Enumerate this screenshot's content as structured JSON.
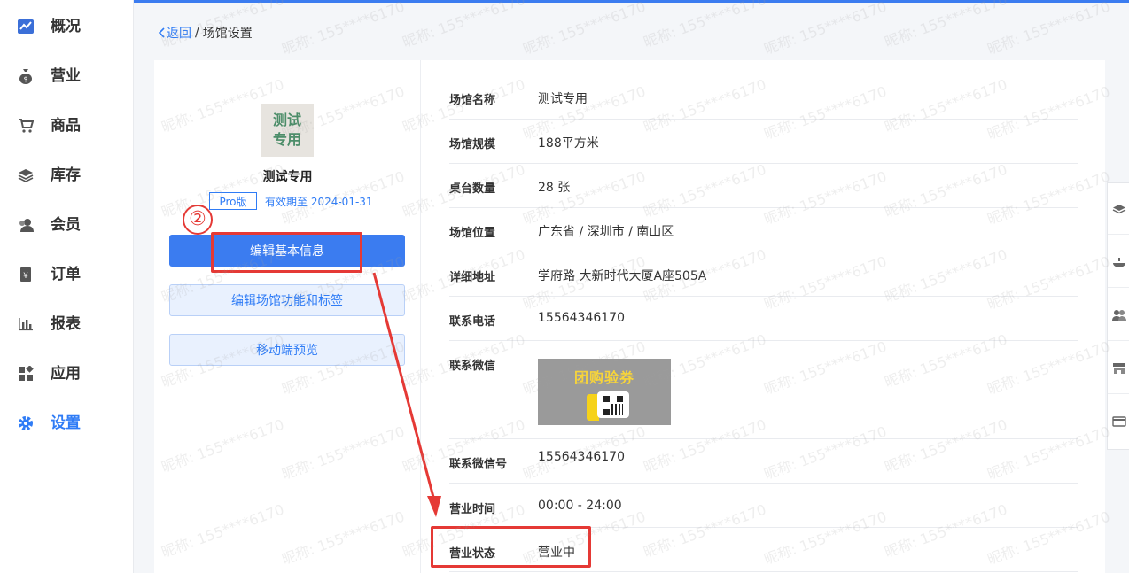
{
  "sidebar": {
    "items": [
      {
        "label": "概况",
        "icon": "trend-chart-icon",
        "active": false
      },
      {
        "label": "营业",
        "icon": "money-bag-icon",
        "active": false
      },
      {
        "label": "商品",
        "icon": "cart-icon",
        "active": false
      },
      {
        "label": "库存",
        "icon": "layers-icon",
        "active": false
      },
      {
        "label": "会员",
        "icon": "user-icon",
        "active": false
      },
      {
        "label": "订单",
        "icon": "order-icon",
        "active": false
      },
      {
        "label": "报表",
        "icon": "bar-chart-icon",
        "active": false
      },
      {
        "label": "应用",
        "icon": "apps-icon",
        "active": false
      },
      {
        "label": "设置",
        "icon": "gear-icon",
        "active": true
      }
    ]
  },
  "breadcrumb": {
    "back": "返回",
    "separator": "/",
    "current": "场馆设置"
  },
  "profile": {
    "logo_line1": "测试",
    "logo_line2": "专用",
    "name": "测试专用",
    "plan": "Pro版",
    "valid_until": "有效期至 2024-01-31"
  },
  "actions": {
    "edit_basic": "编辑基本信息",
    "edit_features": "编辑场馆功能和标签",
    "mobile_preview": "移动端预览"
  },
  "details": {
    "name": {
      "label": "场馆名称",
      "value": "测试专用"
    },
    "size": {
      "label": "场馆规模",
      "value": "188平方米"
    },
    "tables": {
      "label": "桌台数量",
      "value": "28 张"
    },
    "location": {
      "label": "场馆位置",
      "value": "广东省 / 深圳市 / 南山区"
    },
    "address": {
      "label": "详细地址",
      "value": "学府路 大新时代大厦A座505A"
    },
    "phone": {
      "label": "联系电话",
      "value": "15564346170"
    },
    "wechat": {
      "label": "联系微信",
      "image_text": "团购验券"
    },
    "wechat_id": {
      "label": "联系微信号",
      "value": "15564346170"
    },
    "hours": {
      "label": "营业时间",
      "value": "00:00 - 24:00"
    },
    "status": {
      "label": "营业状态",
      "value": "营业中"
    }
  },
  "annotation": {
    "step": "②",
    "color": "#e53935"
  },
  "watermark": {
    "line1": "昵称:",
    "line2": "155****6170"
  },
  "colors": {
    "primary": "#3b7cf0",
    "accent_text": "#2f7cf6"
  }
}
